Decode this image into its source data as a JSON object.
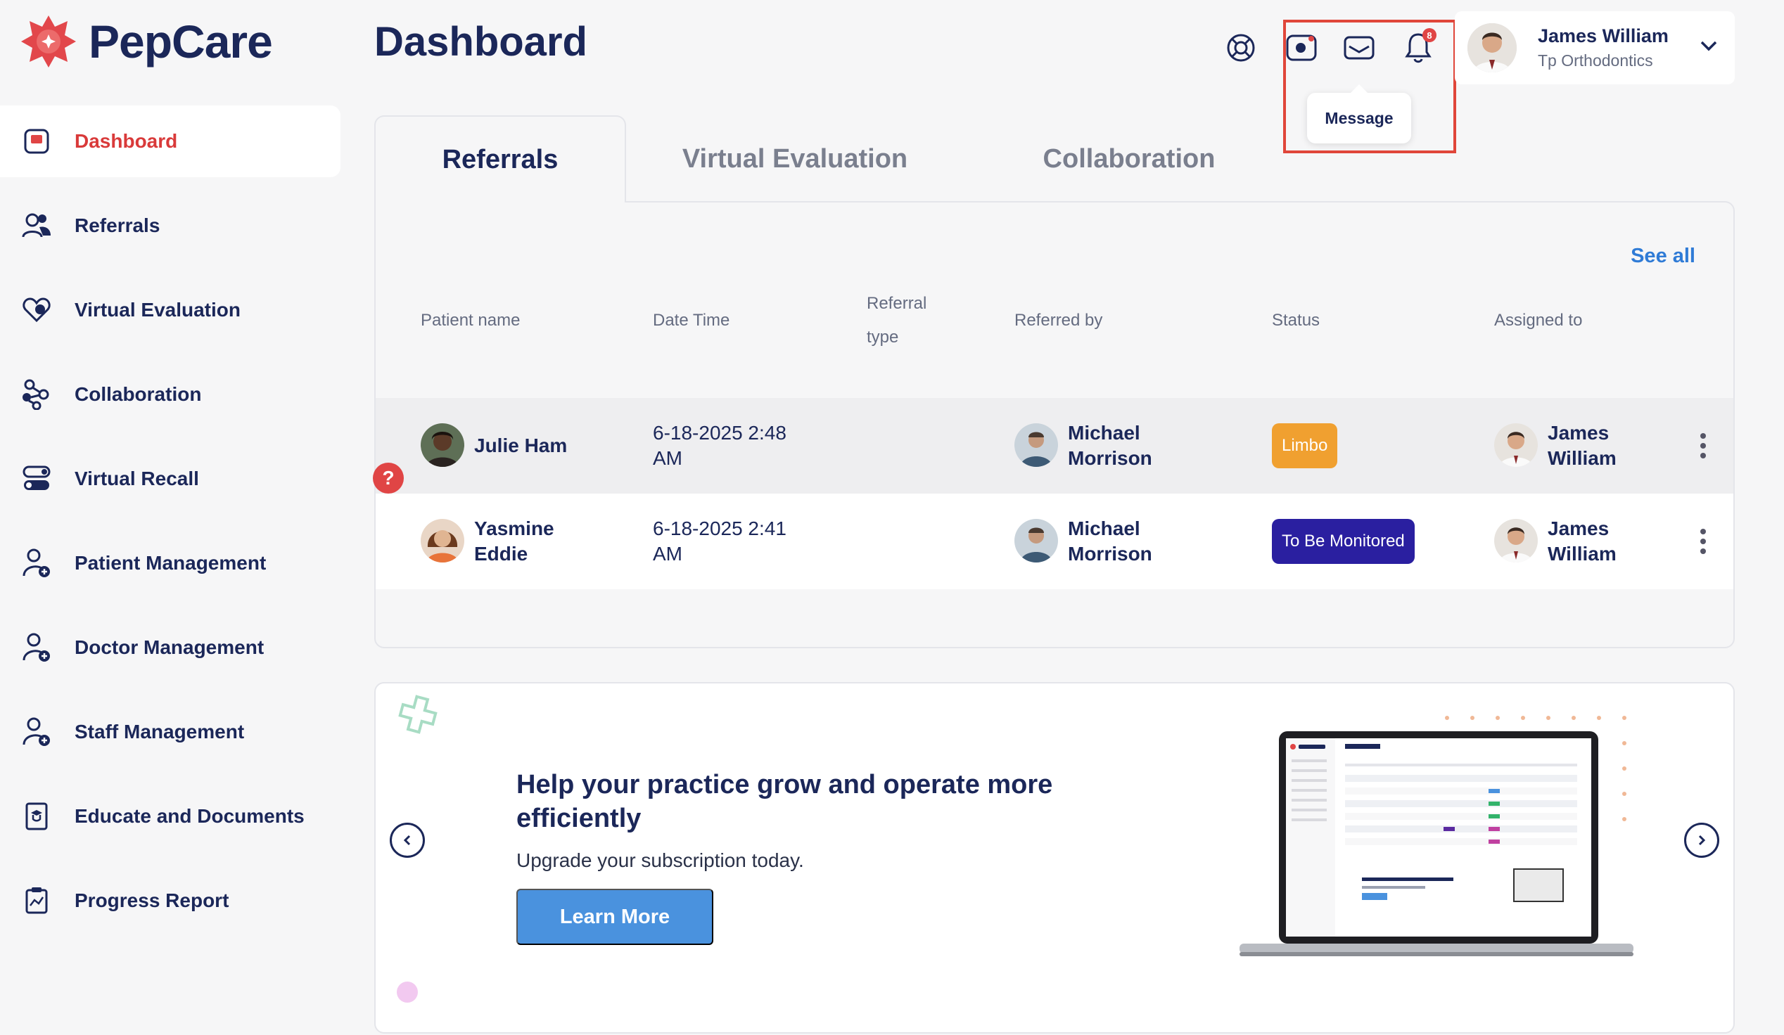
{
  "app": {
    "name": "PepCare",
    "brand_color": "#d93a3a",
    "navy": "#1b2759"
  },
  "sidebar": {
    "items": [
      {
        "label": "Dashboard",
        "icon": "dashboard-icon",
        "active": true
      },
      {
        "label": "Referrals",
        "icon": "users-icon"
      },
      {
        "label": "Virtual Evaluation",
        "icon": "heart-icon"
      },
      {
        "label": "Collaboration",
        "icon": "share-icon"
      },
      {
        "label": "Virtual Recall",
        "icon": "toggle-icon"
      },
      {
        "label": "Patient Management",
        "icon": "user-add-icon"
      },
      {
        "label": "Doctor Management",
        "icon": "user-add-icon"
      },
      {
        "label": "Staff Management",
        "icon": "user-add-icon"
      },
      {
        "label": "Educate and Documents",
        "icon": "document-icon"
      },
      {
        "label": "Progress Report",
        "icon": "clipboard-icon"
      }
    ]
  },
  "header": {
    "title": "Dashboard",
    "icons": [
      "lifebuoy-icon",
      "record-icon",
      "mail-icon",
      "bell-icon"
    ],
    "notification_count": "8",
    "tooltip": "Message",
    "user": {
      "name": "James William",
      "org": "Tp Orthodontics"
    }
  },
  "tabs": [
    {
      "label": "Referrals",
      "active": true
    },
    {
      "label": "Virtual Evaluation"
    },
    {
      "label": "Collaboration"
    }
  ],
  "table": {
    "see_all": "See all",
    "columns": [
      "Patient name",
      "Date Time",
      "Referral type",
      "Referred by",
      "Status",
      "Assigned to"
    ],
    "rows": [
      {
        "patient_line1": "Julie Ham",
        "patient_line2": "",
        "date_line1": "6-18-2025 2:48",
        "date_line2": "AM",
        "referral_type": "",
        "referred_by_line1": "Michael",
        "referred_by_line2": "Morrison",
        "status": "Limbo",
        "status_color": "#f0a030",
        "assigned_line1": "James",
        "assigned_line2": "William"
      },
      {
        "patient_line1": "Yasmine",
        "patient_line2": "Eddie",
        "date_line1": "6-18-2025 2:41",
        "date_line2": "AM",
        "referral_type": "",
        "referred_by_line1": "Michael",
        "referred_by_line2": "Morrison",
        "status": "To Be Monitored",
        "status_color": "#2a1fa0",
        "assigned_line1": "James",
        "assigned_line2": "William"
      }
    ]
  },
  "help": {
    "label": "?"
  },
  "promo": {
    "title": "Help your practice grow and operate more efficiently",
    "subtitle": "Upgrade your subscription today.",
    "button": "Learn More"
  }
}
